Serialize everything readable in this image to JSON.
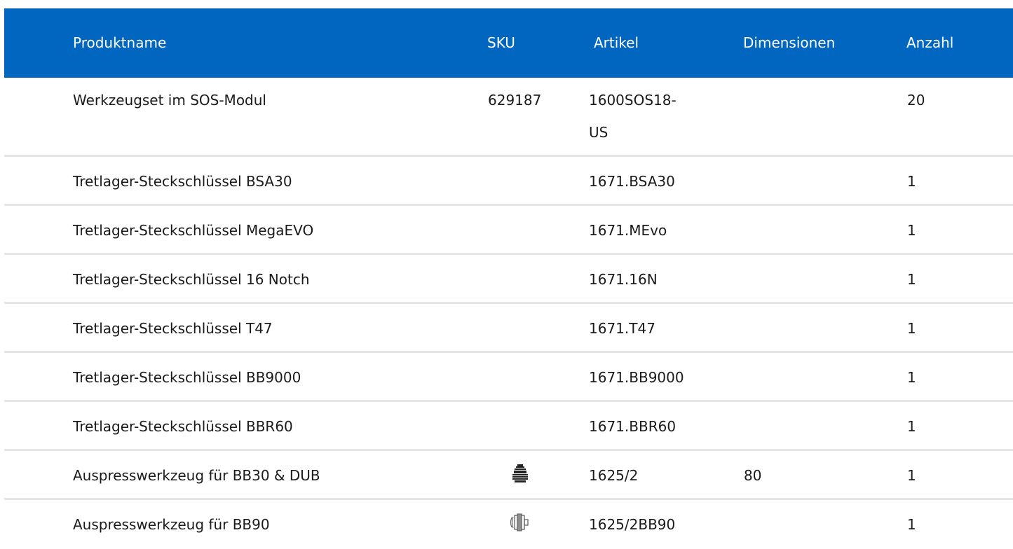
{
  "header": {
    "columns": [
      "Produktname",
      "SKU",
      "Artikel",
      "Dimensionen",
      "Anzahl"
    ]
  },
  "rows": [
    {
      "name": "Werkzeugset im SOS-Modul",
      "sku": "629187",
      "artikel_1": "1600SOS18-",
      "artikel_2": "US",
      "dim": "",
      "qty": "20",
      "icon": ""
    },
    {
      "name": "Tretlager-Steckschlüssel BSA30",
      "sku": "",
      "artikel_1": "1671.BSA30",
      "dim": "",
      "qty": "1",
      "icon": ""
    },
    {
      "name": "Tretlager-Steckschlüssel MegaEVO",
      "sku": "",
      "artikel_1": "1671.MEvo",
      "dim": "",
      "qty": "1",
      "icon": ""
    },
    {
      "name": "Tretlager-Steckschlüssel 16 Notch",
      "sku": "",
      "artikel_1": "1671.16N",
      "dim": "",
      "qty": "1",
      "icon": ""
    },
    {
      "name": "Tretlager-Steckschlüssel T47",
      "sku": "",
      "artikel_1": "1671.T47",
      "dim": "",
      "qty": "1",
      "icon": ""
    },
    {
      "name": "Tretlager-Steckschlüssel BB9000",
      "sku": "",
      "artikel_1": "1671.BB9000",
      "dim": "",
      "qty": "1",
      "icon": ""
    },
    {
      "name": "Tretlager-Steckschlüssel BBR60",
      "sku": "",
      "artikel_1": "1671.BBR60",
      "dim": "",
      "qty": "1",
      "icon": ""
    },
    {
      "name": "Auspresswerkzeug für BB30 & DUB",
      "sku": "",
      "artikel_1": "1625/2",
      "dim": "80",
      "qty": "1",
      "icon": "press-tool-icon"
    },
    {
      "name": "Auspresswerkzeug für BB90",
      "sku": "",
      "artikel_1": "1625/2BB90",
      "dim": "",
      "qty": "1",
      "icon": "bearing-press-icon"
    }
  ],
  "colors": {
    "header_bg": "#0066bf",
    "header_text": "#ffffff",
    "row_divider": "#e6e6e6"
  }
}
